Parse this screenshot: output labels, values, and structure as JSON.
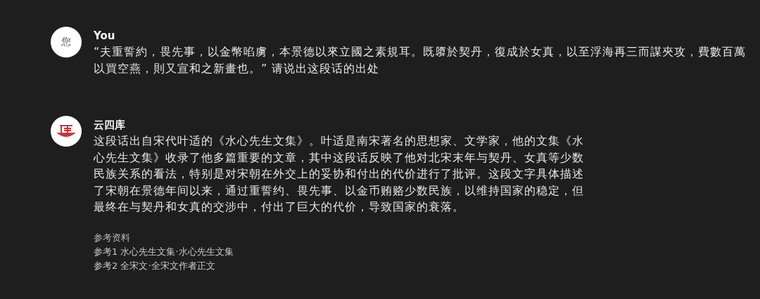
{
  "messages": [
    {
      "kind": "user",
      "avatar_text": "您",
      "name": "You",
      "lines": [
        "“夫重誓約，畏先事，以金幣啗虜，本景德以來立國之素規耳。既隳於契丹，復成於女真，以至浮海再三而謀夾攻，費數百萬",
        "以買空燕，則又宣和之新畫也。” 请说出这段话的出处"
      ]
    },
    {
      "kind": "bot",
      "name": "云四库",
      "lines": [
        "这段话出自宋代叶适的《水心先生文集》。叶适是南宋著名的思想家、文学家，他的文集《水",
        "心先生文集》收录了他多篇重要的文章，其中这段话反映了他对北宋末年与契丹、女真等少数",
        "民族关系的看法，特别是对宋朝在外交上的妥协和付出的代价进行了批评。这段文字具体描述",
        "了宋朝在景德年间以来，通过重誓约、畏先事、以金币贿赂少数民族，以维持国家的稳定，但",
        "最终在与契丹和女真的交涉中，付出了巨大的代价，导致国家的衰落。"
      ],
      "references": {
        "title": "参考资料",
        "items": [
          "参考1 水心先生文集·水心先生文集",
          "参考2 全宋文·全宋文作者正文"
        ]
      }
    }
  ]
}
